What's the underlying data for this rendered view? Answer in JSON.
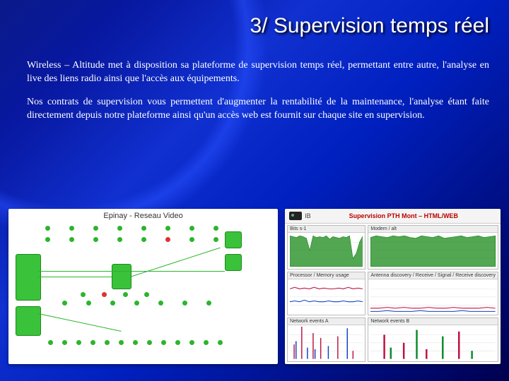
{
  "title": "3/ Supervision temps réel",
  "paragraph1": "Wireless – Altitude met à disposition sa plateforme de supervision temps réel, permettant entre autre, l'analyse en live des liens radio ainsi que l'accès aux équipements.",
  "paragraph2": "Nos contrats de supervision vous permettent d'augmenter la rentabilité de la maintenance, l'analyse étant faite directement depuis notre plateforme ainsi qu'un accès web est fournit sur chaque site en supervision.",
  "diagram": {
    "title": "Epinay - Reseau Video",
    "dots": [
      [
        46,
        6,
        "g"
      ],
      [
        80,
        6,
        "g"
      ],
      [
        114,
        6,
        "g"
      ],
      [
        148,
        6,
        "g"
      ],
      [
        182,
        6,
        "g"
      ],
      [
        216,
        6,
        "g"
      ],
      [
        250,
        6,
        "g"
      ],
      [
        284,
        6,
        "g"
      ],
      [
        46,
        22,
        "g"
      ],
      [
        80,
        22,
        "g"
      ],
      [
        114,
        22,
        "g"
      ],
      [
        148,
        22,
        "g"
      ],
      [
        182,
        22,
        "g"
      ],
      [
        216,
        22,
        "r"
      ],
      [
        250,
        22,
        "g"
      ],
      [
        284,
        22,
        "g"
      ],
      [
        70,
        112,
        "g"
      ],
      [
        104,
        112,
        "g"
      ],
      [
        138,
        112,
        "g"
      ],
      [
        172,
        112,
        "g"
      ],
      [
        206,
        112,
        "g"
      ],
      [
        240,
        112,
        "g"
      ],
      [
        274,
        112,
        "g"
      ],
      [
        96,
        100,
        "g"
      ],
      [
        126,
        100,
        "r"
      ],
      [
        156,
        100,
        "g"
      ],
      [
        186,
        100,
        "g"
      ],
      [
        50,
        168,
        "g"
      ],
      [
        70,
        168,
        "g"
      ],
      [
        90,
        168,
        "g"
      ],
      [
        110,
        168,
        "g"
      ],
      [
        130,
        168,
        "g"
      ],
      [
        150,
        168,
        "g"
      ],
      [
        170,
        168,
        "g"
      ],
      [
        190,
        168,
        "g"
      ],
      [
        210,
        168,
        "g"
      ],
      [
        230,
        168,
        "g"
      ],
      [
        250,
        168,
        "g"
      ],
      [
        270,
        168,
        "g"
      ],
      [
        290,
        168,
        "g"
      ]
    ]
  },
  "dashboard": {
    "brand": "IB",
    "title": "Supervision PTH Mont – HTML/WEB",
    "panels": [
      {
        "title": "Bits s-1",
        "type": "area",
        "color": "#1a8a1a",
        "series": [
          38,
          37,
          36,
          38,
          37,
          35,
          20,
          38,
          36,
          37,
          36,
          38,
          34,
          37,
          36,
          35,
          37,
          36,
          38,
          10,
          16,
          30,
          38
        ]
      },
      {
        "title": "Modem / alt",
        "type": "area",
        "color": "#1a8a1a",
        "series": [
          36,
          38,
          37,
          36,
          38,
          37,
          38,
          36,
          35,
          38,
          37,
          36,
          38,
          35,
          36,
          37,
          38,
          36,
          37,
          38,
          36,
          37,
          38
        ]
      },
      {
        "title": "Processor / Memory usage",
        "type": "line2",
        "s1": [
          30,
          32,
          30,
          31,
          30,
          32,
          30,
          31,
          30,
          30,
          31,
          30,
          32,
          30,
          31,
          30
        ],
        "s2": [
          14,
          15,
          14,
          16,
          14,
          15,
          14,
          14,
          15,
          14,
          14,
          15,
          14,
          14,
          15,
          14
        ]
      },
      {
        "title": "Antenna discovery / Receive / Signal / Receive discovery",
        "type": "line2",
        "s1": [
          6,
          6,
          7,
          6,
          7,
          6,
          6,
          7,
          6,
          6,
          7,
          6,
          6,
          6,
          7,
          6
        ],
        "s2": [
          2,
          2,
          3,
          2,
          2,
          2,
          3,
          2,
          2,
          2,
          2,
          3,
          2,
          2,
          2,
          2
        ]
      },
      {
        "title": "Network events A",
        "type": "spikes",
        "color1": "#c01040",
        "color2": "#1040c0",
        "pts": [
          [
            2,
            18
          ],
          [
            3,
            22
          ],
          [
            6,
            40
          ],
          [
            9,
            14
          ],
          [
            12,
            32
          ],
          [
            13,
            12
          ],
          [
            16,
            26
          ],
          [
            20,
            16
          ],
          [
            25,
            28
          ],
          [
            30,
            38
          ],
          [
            33,
            10
          ]
        ]
      },
      {
        "title": "Network events B",
        "type": "spikes",
        "color1": "#c01040",
        "color2": "#0a8a2a",
        "pts": [
          [
            4,
            30
          ],
          [
            6,
            14
          ],
          [
            10,
            20
          ],
          [
            14,
            36
          ],
          [
            17,
            12
          ],
          [
            22,
            28
          ],
          [
            27,
            34
          ],
          [
            31,
            10
          ]
        ]
      }
    ]
  }
}
